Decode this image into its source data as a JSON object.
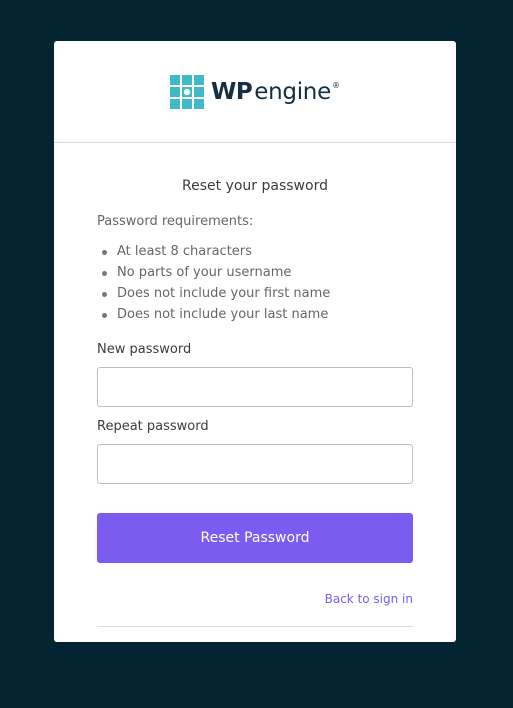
{
  "brand": {
    "name_bold": "WP",
    "name_light": "engine",
    "registered": "®",
    "logo_icon": "wp-engine-grid-icon",
    "colors": {
      "background": "#022433",
      "accent": "#7b5cf0",
      "logo_teal": "#40bac8",
      "logo_text": "#162e44"
    }
  },
  "form": {
    "title": "Reset your password",
    "requirements_label": "Password requirements:",
    "requirements": [
      "At least 8 characters",
      "No parts of your username",
      "Does not include your first name",
      "Does not include your last name"
    ],
    "new_password_label": "New password",
    "new_password_value": "",
    "repeat_password_label": "Repeat password",
    "repeat_password_value": "",
    "submit_label": "Reset Password",
    "back_link": "Back to sign in"
  }
}
